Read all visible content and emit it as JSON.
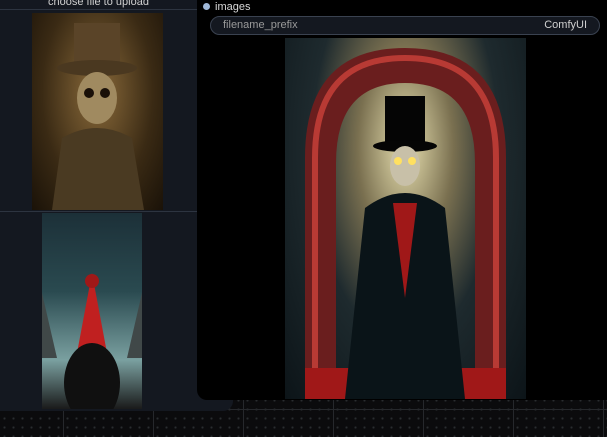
{
  "load_node": {
    "upload_button": "choose file to upload"
  },
  "save_node": {
    "input_label": "images",
    "field_name": "filename_prefix",
    "field_value": "ComfyUI"
  },
  "colors": {
    "input_dot": "#a0b8d8",
    "node_bg": "#141820"
  }
}
